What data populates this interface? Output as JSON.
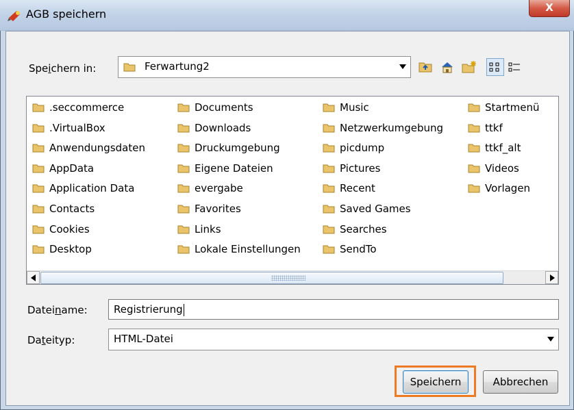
{
  "window": {
    "title": "AGB speichern",
    "close_label": "X"
  },
  "save_in": {
    "label_pre": "Spe",
    "label_accel": "i",
    "label_post": "chern in:",
    "value": "Ferwartung2"
  },
  "toolbar": {
    "icons": [
      "up-folder-icon",
      "home-icon",
      "new-folder-icon",
      "list-view-icon",
      "details-view-icon"
    ],
    "active": "list-view-icon"
  },
  "folders": {
    "col1": [
      ".seccommerce",
      ".VirtualBox",
      "Anwendungsdaten",
      "AppData",
      "Application Data",
      "Contacts",
      "Cookies",
      "Desktop"
    ],
    "col2": [
      "Documents",
      "Downloads",
      "Druckumgebung",
      "Eigene Dateien",
      "evergabe",
      "Favorites",
      "Links",
      "Lokale Einstellungen"
    ],
    "col3": [
      "Music",
      "Netzwerkumgebung",
      "picdump",
      "Pictures",
      "Recent",
      "Saved Games",
      "Searches",
      "SendTo"
    ],
    "col4": [
      "Startmenü",
      "ttkf",
      "ttkf_alt",
      "Videos",
      "Vorlagen"
    ]
  },
  "filename": {
    "label_pre": "Datei",
    "label_accel": "n",
    "label_post": "ame:",
    "value": "Registrierung"
  },
  "filetype": {
    "label_pre": "Da",
    "label_accel": "t",
    "label_post": "eityp:",
    "value": "HTML-Datei"
  },
  "buttons": {
    "save": "Speichern",
    "cancel": "Abbrechen"
  },
  "colors": {
    "highlight": "#ef7a24",
    "folder": "#e9c46a"
  }
}
